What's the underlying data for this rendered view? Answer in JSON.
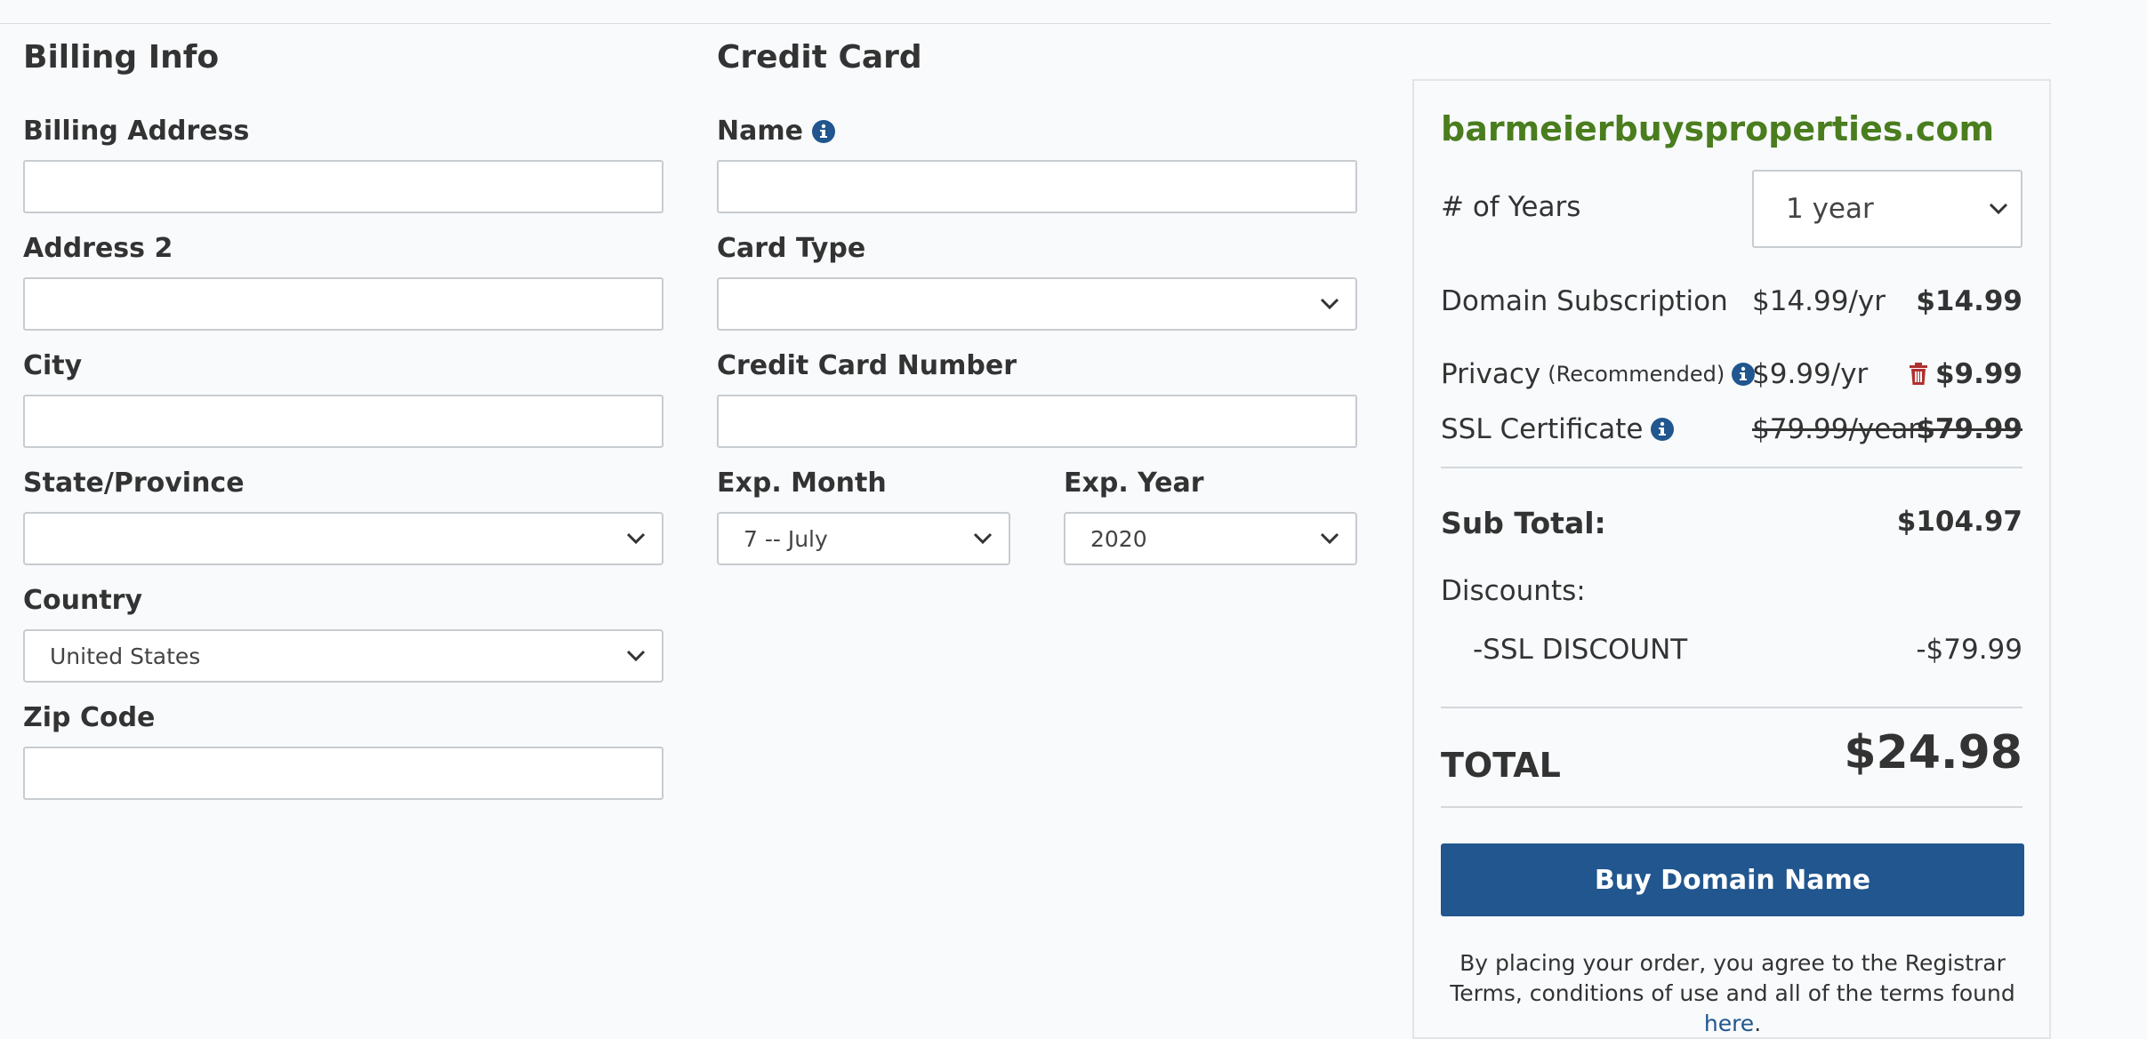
{
  "billing": {
    "title": "Billing Info",
    "address_label": "Billing Address",
    "address2_label": "Address 2",
    "city_label": "City",
    "state_label": "State/Province",
    "state_value": "",
    "country_label": "Country",
    "country_value": "United States",
    "zip_label": "Zip Code"
  },
  "card": {
    "title": "Credit Card",
    "name_label": "Name",
    "type_label": "Card Type",
    "type_value": "",
    "number_label": "Credit Card Number",
    "exp_month_label": "Exp. Month",
    "exp_month_value": "7 -- July",
    "exp_year_label": "Exp. Year",
    "exp_year_value": "2020"
  },
  "summary": {
    "domain": "barmeierbuysproperties.com",
    "years_label": "# of Years",
    "years_value": "1 year",
    "subscription": {
      "name": "Domain Subscription",
      "rate": "$14.99/yr",
      "price": "$14.99"
    },
    "privacy": {
      "name": "Privacy",
      "note": "(Recommended)",
      "rate": "$9.99/yr",
      "price": "$9.99"
    },
    "ssl": {
      "name": "SSL Certificate",
      "rate": "$79.99/year",
      "price": "$79.99"
    },
    "subtotal_label": "Sub Total:",
    "subtotal_value": "$104.97",
    "discounts_label": "Discounts:",
    "discount_name": "-SSL DISCOUNT",
    "discount_value": "-$79.99",
    "total_label": "TOTAL",
    "total_value": "$24.98",
    "buy_label": "Buy Domain Name",
    "terms_text": "By placing your order, you agree to the Registrar Terms, conditions of use and all of the terms found",
    "terms_link": "here",
    "terms_end": "."
  },
  "colors": {
    "accent": "#21568e",
    "domain_green": "#4a7d1e",
    "trash_red": "#b03030",
    "background": "#f8fafc"
  },
  "icons": [
    "info-icon",
    "trash-icon",
    "chevron-down-icon"
  ]
}
